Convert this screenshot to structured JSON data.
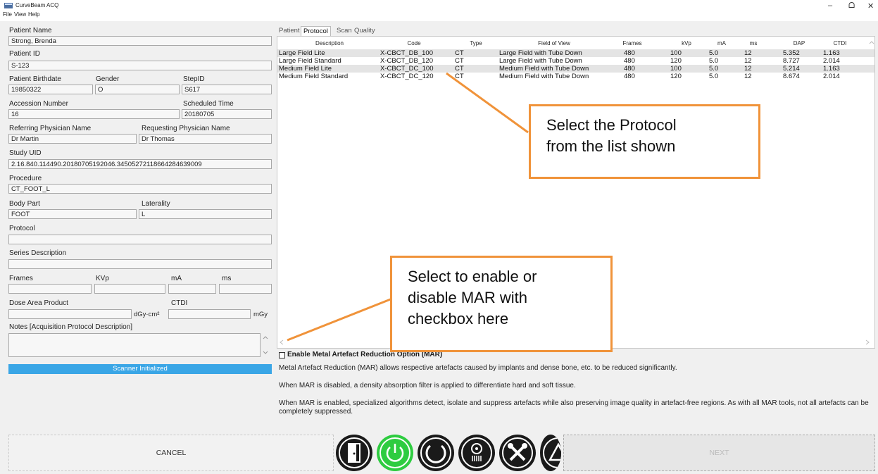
{
  "window": {
    "title": "CurveBeam ACQ",
    "menu": [
      "File",
      "View",
      "Help"
    ],
    "controls": {
      "minimize": "–",
      "maximize": "ᗝ",
      "close": "✕"
    }
  },
  "form": {
    "patient_name_label": "Patient Name",
    "patient_name": "Strong, Brenda",
    "patient_id_label": "Patient ID",
    "patient_id": "S-123",
    "birthdate_label": "Patient Birthdate",
    "birthdate": "19850322",
    "gender_label": "Gender",
    "gender": "O",
    "stepid_label": "StepID",
    "stepid": "S617",
    "accession_label": "Accession Number",
    "accession": "16",
    "scheduled_label": "Scheduled Time",
    "scheduled": "20180705",
    "referring_label": "Referring Physician Name",
    "referring": "Dr Martin",
    "requesting_label": "Requesting Physician Name",
    "requesting": "Dr Thomas",
    "study_uid_label": "Study UID",
    "study_uid": "2.16.840.114490.20180705192046.34505272118664284639009",
    "procedure_label": "Procedure",
    "procedure": "CT_FOOT_L",
    "body_part_label": "Body Part",
    "body_part": "FOOT",
    "laterality_label": "Laterality",
    "laterality": "L",
    "protocol_label": "Protocol",
    "protocol": "",
    "series_label": "Series Description",
    "series": "",
    "frames_label": "Frames",
    "kvp_label": "KVp",
    "ma_label": "mA",
    "ms_label": "ms",
    "dap_label": "Dose Area Product",
    "dap_unit": "dGy·cm²",
    "ctdi_label": "CTDI",
    "ctdi_unit": "mGy",
    "notes_label": "Notes [Acquisition Protocol Description]",
    "status": "Scanner Initialized"
  },
  "tabs": [
    "Patient",
    "Protocol",
    "Scan",
    "Quality"
  ],
  "table": {
    "headers": [
      "Description",
      "Code",
      "Type",
      "Field of View",
      "Frames",
      "kVp",
      "mA",
      "ms",
      "DAP",
      "CTDI"
    ],
    "rows": [
      [
        "Large Field Lite",
        "X-CBCT_DB_100",
        "CT",
        "Large Field with Tube Down",
        "480",
        "100",
        "5.0",
        "12",
        "5.352",
        "1.163"
      ],
      [
        "Large Field Standard",
        "X-CBCT_DB_120",
        "CT",
        "Large Field with Tube Down",
        "480",
        "120",
        "5.0",
        "12",
        "8.727",
        "2.014"
      ],
      [
        "Medium Field Lite",
        "X-CBCT_DC_100",
        "CT",
        "Medium Field with Tube Down",
        "480",
        "100",
        "5.0",
        "12",
        "5.214",
        "1.163"
      ],
      [
        "Medium Field Standard",
        "X-CBCT_DC_120",
        "CT",
        "Medium Field with Tube Down",
        "480",
        "120",
        "5.0",
        "12",
        "8.674",
        "2.014"
      ]
    ]
  },
  "callouts": {
    "protocol_line1": "Select the Protocol",
    "protocol_line2": "from the list shown",
    "mar_line1": "Select to enable or",
    "mar_line2": "disable MAR with",
    "mar_line3": "checkbox here"
  },
  "mar": {
    "label": "Enable Metal Artefact Reduction Option (MAR)",
    "checked": false,
    "p1": "Metal Artefact Reduction (MAR) allows respective artefacts caused by implants and dense bone, etc. to be reduced significantly.",
    "p2": "When MAR is disabled, a density absorption filter is applied to differentiate hard and soft tissue.",
    "p3": "When MAR is enabled, specialized algorithms detect, isolate and suppress artefacts while also preserving image quality in artefact-free regions. As with all MAR tools, not all artefacts can be completely suppressed."
  },
  "buttons": {
    "cancel": "CANCEL",
    "next": "NEXT"
  },
  "icons": [
    "door-exit-icon",
    "power-icon",
    "refresh-icon",
    "radiation-icon",
    "tools-icon",
    "warning-icon"
  ],
  "colors": {
    "accent": "#3aa6e6",
    "callout_border": "#f0933a",
    "power_green": "#2ecc40"
  }
}
